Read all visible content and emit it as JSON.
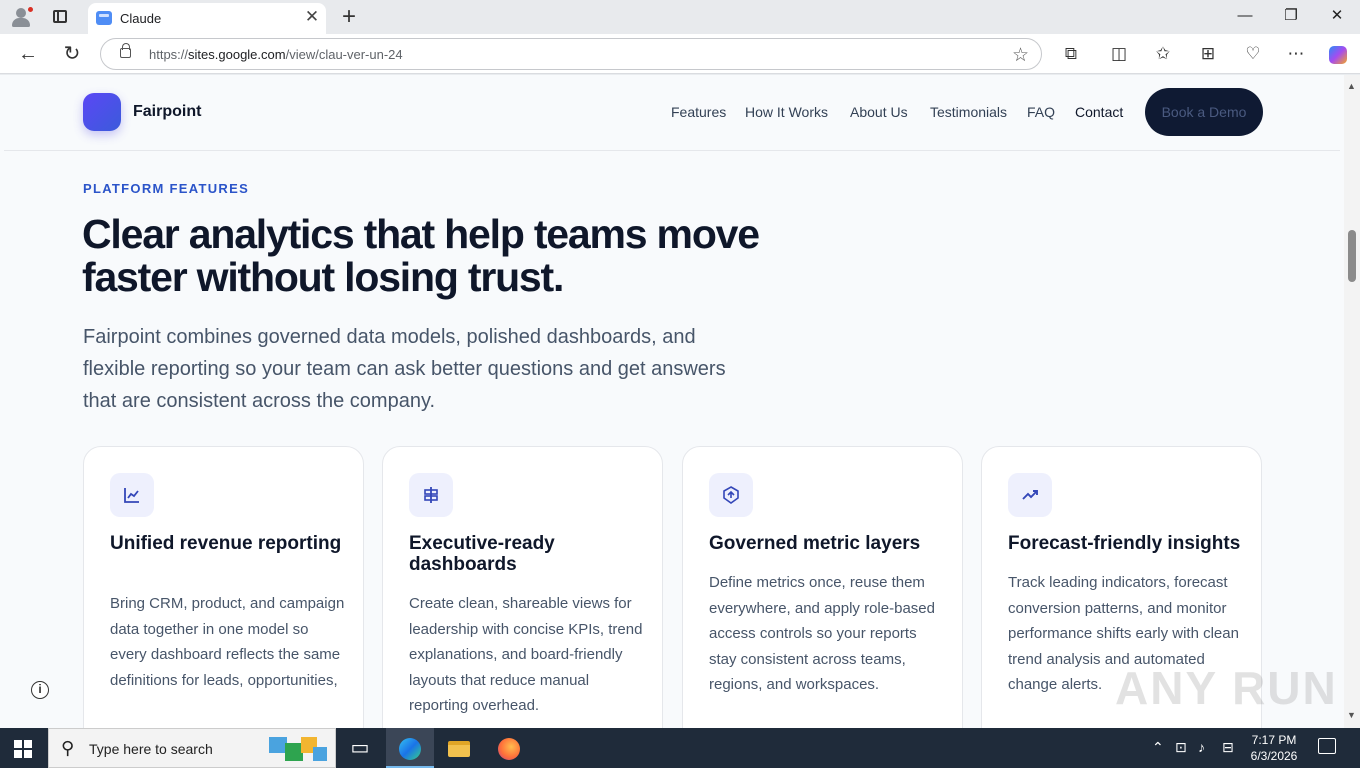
{
  "browser": {
    "tab_title": "Claude",
    "url_prefix": "https://",
    "url_host": "sites.google.com",
    "url_path": "/view/clau-ver-un-24"
  },
  "site": {
    "logo_text": "Fairpoint",
    "nav": [
      "Features",
      "How It Works",
      "About Us",
      "Testimonials",
      "FAQ",
      "Contact"
    ],
    "cta_label": "Book a Demo"
  },
  "hero": {
    "eyebrow": "PLATFORM FEATURES",
    "title": "Clear analytics that help teams move faster without losing trust.",
    "description": "Fairpoint combines governed data models, polished dashboards, and flexible reporting so your team can ask better questions and get answers that are consistent across the company."
  },
  "cards": [
    {
      "icon": "chart-line-icon",
      "title": "Unified revenue reporting",
      "description": "Bring CRM, product, and campaign data together in one model so every dashboard reflects the same definitions for leads, opportunities,"
    },
    {
      "icon": "dashboard-icon",
      "title": "Executive-ready dashboards",
      "description": "Create clean, shareable views for leadership with concise KPIs, trend explanations, and board-friendly layouts that reduce manual reporting overhead."
    },
    {
      "icon": "shield-icon",
      "title": "Governed metric layers",
      "description": "Define metrics once, reuse them everywhere, and apply role-based access controls so your reports stay consistent across teams, regions, and workspaces."
    },
    {
      "icon": "trend-up-icon",
      "title": "Forecast-friendly insights",
      "description": "Track leading indicators, forecast conversion patterns, and monitor performance shifts early with clean trend analysis and automated change alerts."
    }
  ],
  "watermark": "ANY RUN",
  "taskbar": {
    "search_placeholder": "Type here to search",
    "time": "7:17 PM",
    "date": "6/3/2026"
  }
}
